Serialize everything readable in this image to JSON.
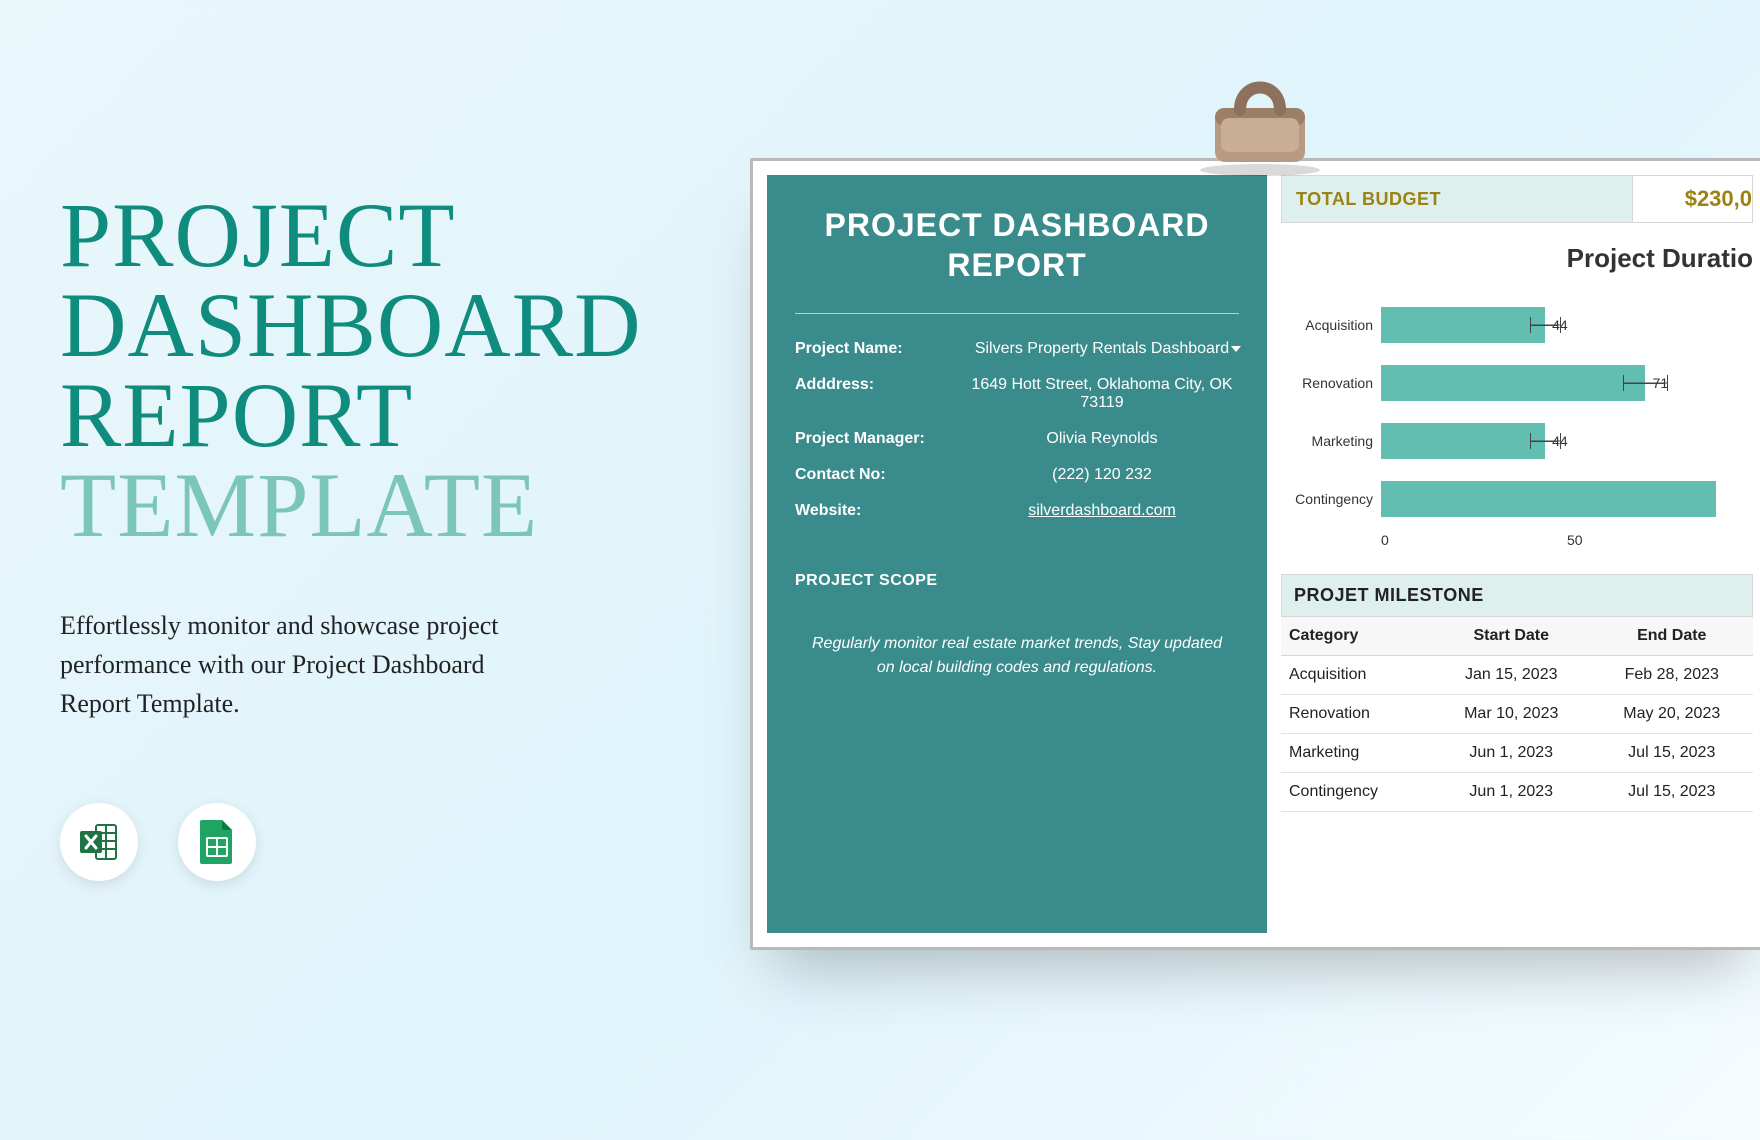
{
  "hero": {
    "title_l1": "PROJECT",
    "title_l2": "DASHBOARD",
    "title_l3": "REPORT",
    "title_l4": "TEMPLATE",
    "subtitle": "Effortlessly monitor and showcase project performance with our Project Dashboard Report Template."
  },
  "icons": {
    "excel": "excel-icon",
    "sheets": "google-sheets-icon"
  },
  "dashboard": {
    "card_title": "PROJECT DASHBOARD REPORT",
    "info": {
      "project_name_label": "Project Name:",
      "project_name": "Silvers Property Rentals Dashboard",
      "address_label": "Adddress:",
      "address": "1649 Hott Street, Oklahoma City, OK 73119",
      "pm_label": "Project Manager:",
      "pm": "Olivia Reynolds",
      "contact_label": "Contact No:",
      "contact": "(222) 120 232",
      "website_label": "Website:",
      "website": "silverdashboard.com"
    },
    "scope_label": "PROJECT SCOPE",
    "scope_text": "Regularly monitor real estate market trends, Stay updated on local building codes and regulations.",
    "budget_label": "TOTAL BUDGET",
    "budget_value": "$230,0",
    "chart_title": "Project Duratio",
    "milestone_header": "PROJET  MILESTONE",
    "ms_cols": {
      "c1": "Category",
      "c2": "Start Date",
      "c3": "End Date"
    },
    "ms_rows": [
      {
        "cat": "Acquisition",
        "start": "Jan 15, 2023",
        "end": "Feb 28, 2023"
      },
      {
        "cat": "Renovation",
        "start": "Mar 10, 2023",
        "end": "May 20, 2023"
      },
      {
        "cat": "Marketing",
        "start": "Jun 1, 2023",
        "end": "Jul 15, 2023"
      },
      {
        "cat": "Contingency",
        "start": "Jun 1, 2023",
        "end": "Jul 15, 2023"
      }
    ]
  },
  "chart_data": {
    "type": "bar",
    "orientation": "horizontal",
    "title": "Project Duratio",
    "xlabel": "",
    "ylabel": "",
    "categories": [
      "Acquisition",
      "Renovation",
      "Marketing",
      "Contingency"
    ],
    "values": [
      44,
      71,
      44,
      90
    ],
    "errors": [
      4,
      6,
      4,
      0
    ],
    "data_labels": [
      "44",
      "71",
      "44",
      ""
    ],
    "xticks": [
      0,
      50
    ],
    "xlim": [
      0,
      100
    ]
  }
}
